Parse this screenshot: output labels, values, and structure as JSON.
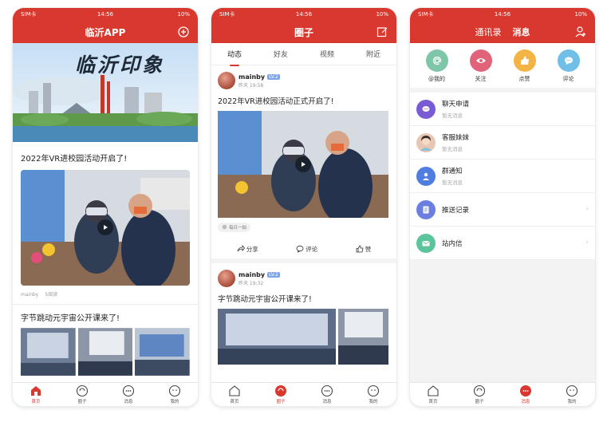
{
  "status": {
    "carrier": "SIM卡",
    "time": "14:56",
    "battery": "10%"
  },
  "phone1": {
    "title": "临沂APP",
    "banner_text": "临沂印象",
    "article1": {
      "title": "2022年VR进校园活动开启了!",
      "author": "mainby",
      "reads": "5阅读"
    },
    "article2": {
      "title": "字节跳动元宇宙公开课来了!"
    },
    "tabs": [
      "首页",
      "圈子",
      "消息",
      "我的"
    ]
  },
  "phone2": {
    "title": "圈子",
    "subtabs": [
      "动态",
      "好友",
      "视频",
      "附近"
    ],
    "post1": {
      "user": "mainby",
      "level": "LV.2",
      "time": "昨天 19:58",
      "title": "2022年VR进校园活动正式开启了!",
      "tag": "每日一拍",
      "share": "分享",
      "comment": "评论",
      "like": "赞"
    },
    "post2": {
      "user": "mainby",
      "level": "LV.2",
      "time": "昨天 19:32",
      "title": "字节跳动元宇宙公开课来了!"
    },
    "tabs": [
      "首页",
      "圈子",
      "消息",
      "我的"
    ]
  },
  "phone3": {
    "nav_tabs": [
      "通讯录",
      "消息"
    ],
    "top_icons": [
      {
        "label": "@我的",
        "color": "#7ec6a8"
      },
      {
        "label": "关注",
        "color": "#e0637a"
      },
      {
        "label": "点赞",
        "color": "#f3b445"
      },
      {
        "label": "评论",
        "color": "#6fbfe8"
      }
    ],
    "rows": [
      {
        "title": "聊天申请",
        "sub": "暂无消息",
        "color": "#7a5bd6"
      },
      {
        "title": "客服妹妹",
        "sub": "暂无消息",
        "color": "#e7c6b4"
      },
      {
        "title": "群通知",
        "sub": "暂无消息",
        "color": "#4f7de0"
      },
      {
        "title": "推送记录",
        "sub": "",
        "color": "#6b7fe0"
      },
      {
        "title": "站内信",
        "sub": "",
        "color": "#5cc49a"
      }
    ],
    "tabs": [
      "首页",
      "圈子",
      "消息",
      "我的"
    ]
  },
  "colors": {
    "brand_red": "#d9382e"
  }
}
